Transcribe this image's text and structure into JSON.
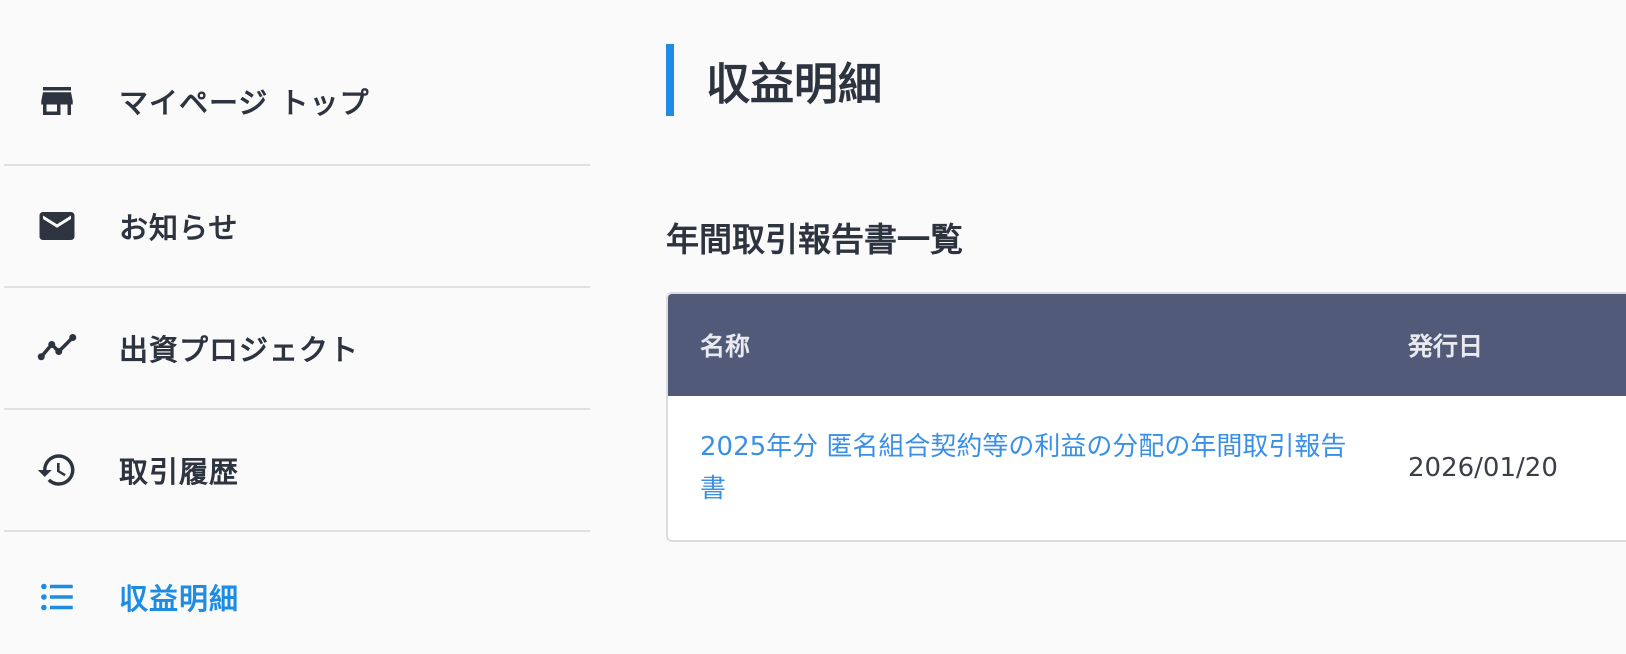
{
  "sidebar": {
    "items": [
      {
        "label": "マイページ トップ",
        "icon": "store-icon",
        "active": false
      },
      {
        "label": "お知らせ",
        "icon": "mail-icon",
        "active": false
      },
      {
        "label": "出資プロジェクト",
        "icon": "trending-icon",
        "active": false
      },
      {
        "label": "取引履歴",
        "icon": "history-icon",
        "active": false
      },
      {
        "label": "収益明細",
        "icon": "list-icon",
        "active": true
      }
    ]
  },
  "main": {
    "page_title": "収益明細",
    "section_title": "年間取引報告書一覧",
    "table": {
      "headers": {
        "name": "名称",
        "issue_date": "発行日"
      },
      "rows": [
        {
          "name": "2025年分 匿名組合契約等の利益の分配の年間取引報告書",
          "issue_date": "2026/01/20"
        }
      ]
    }
  },
  "colors": {
    "accent": "#1f8ce3",
    "link": "#3a90e6",
    "table_header_bg": "#525a79",
    "text": "#2d3440",
    "background": "#fafafa"
  }
}
